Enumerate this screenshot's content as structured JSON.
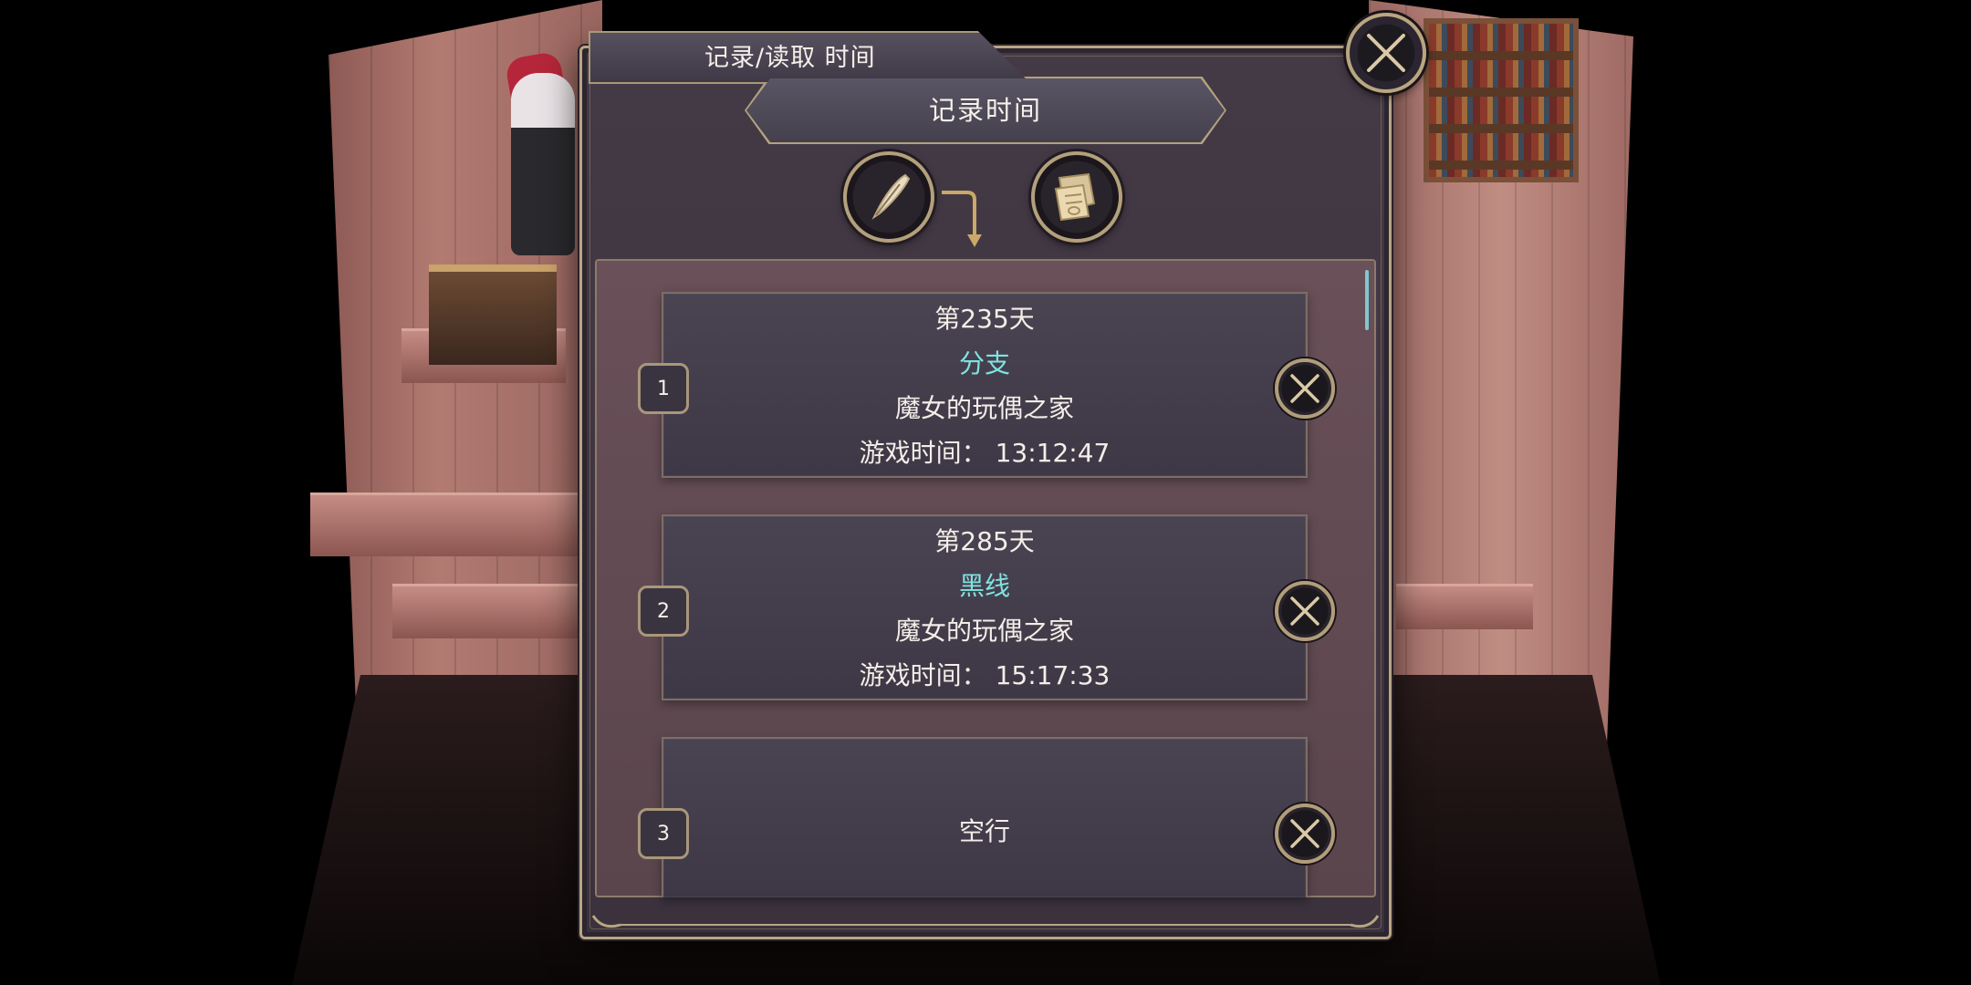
{
  "dialog": {
    "title": "记录/读取 时间",
    "close_icon": "close-x-icon"
  },
  "banner": {
    "text": "记录时间"
  },
  "mode_buttons": [
    {
      "name": "save",
      "icon": "quill-pen-icon"
    },
    {
      "name": "load",
      "icon": "scroll-paper-icon"
    }
  ],
  "slots": [
    {
      "number": "1",
      "day": "第235天",
      "route": "分支",
      "place": "魔女的玩偶之家",
      "time": "游戏时间： 13:12:47",
      "empty": false
    },
    {
      "number": "2",
      "day": "第285天",
      "route": "黑线",
      "place": "魔女的玩偶之家",
      "time": "游戏时间： 15:17:33",
      "empty": false
    },
    {
      "number": "3",
      "empty_text": "空行",
      "empty": true
    }
  ],
  "colors": {
    "route_text": "#7fe3e0",
    "frame_gold": "#b7a684",
    "panel_bg": "#443a46"
  }
}
